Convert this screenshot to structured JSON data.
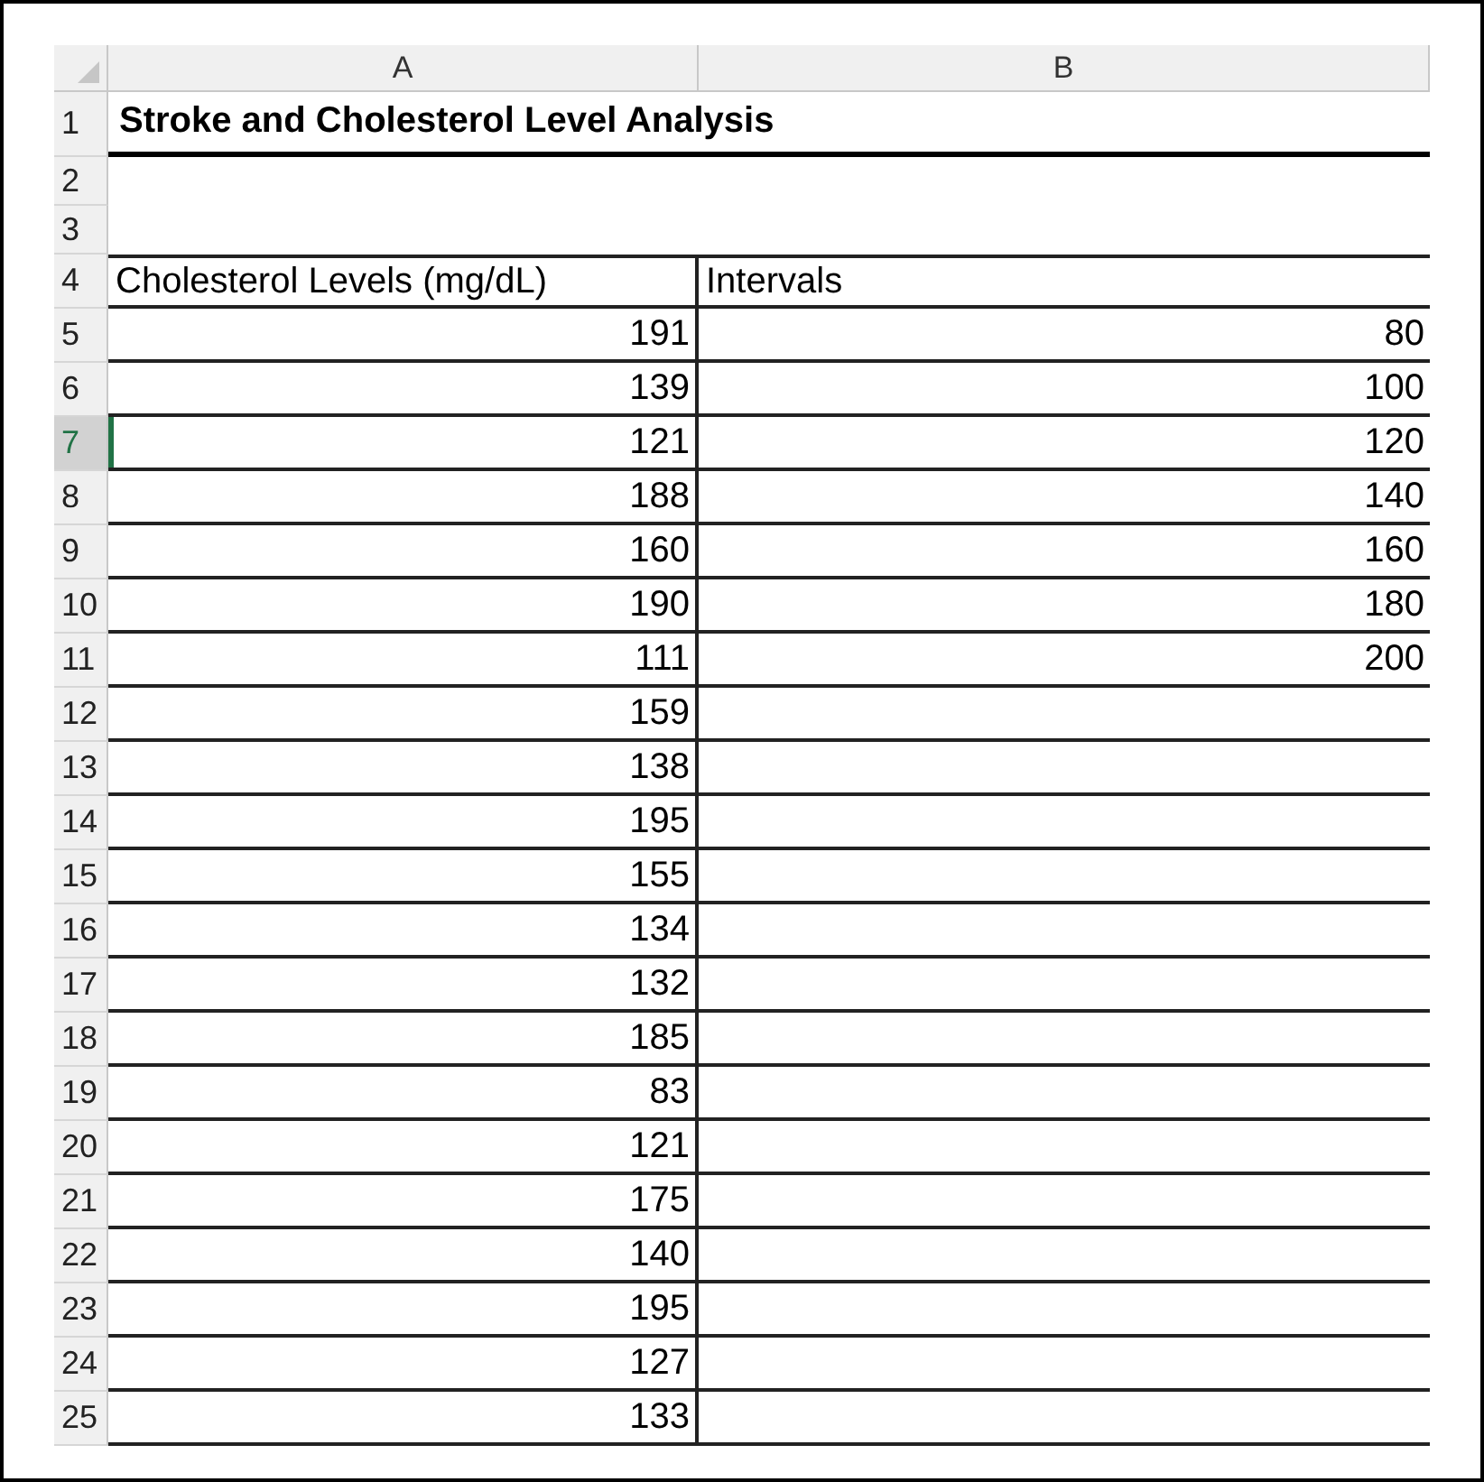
{
  "columns": [
    {
      "label": "A"
    },
    {
      "label": "B"
    }
  ],
  "rows": [
    {
      "number": "1",
      "kind": "title",
      "selected": false,
      "a": "Stroke and Cholesterol Level Analysis"
    },
    {
      "number": "2",
      "kind": "blank",
      "selected": false
    },
    {
      "number": "3",
      "kind": "blank",
      "selected": false
    },
    {
      "number": "4",
      "kind": "header",
      "selected": false,
      "a": "Cholesterol Levels (mg/dL)",
      "b": "Intervals"
    },
    {
      "number": "5",
      "kind": "data",
      "selected": false,
      "a": "191",
      "b": "80"
    },
    {
      "number": "6",
      "kind": "data",
      "selected": false,
      "a": "139",
      "b": "100"
    },
    {
      "number": "7",
      "kind": "data",
      "selected": true,
      "a": "121",
      "b": "120"
    },
    {
      "number": "8",
      "kind": "data",
      "selected": false,
      "a": "188",
      "b": "140"
    },
    {
      "number": "9",
      "kind": "data",
      "selected": false,
      "a": "160",
      "b": "160"
    },
    {
      "number": "10",
      "kind": "data",
      "selected": false,
      "a": "190",
      "b": "180"
    },
    {
      "number": "11",
      "kind": "data",
      "selected": false,
      "a": "111",
      "b": "200"
    },
    {
      "number": "12",
      "kind": "data",
      "selected": false,
      "a": "159"
    },
    {
      "number": "13",
      "kind": "data",
      "selected": false,
      "a": "138"
    },
    {
      "number": "14",
      "kind": "data",
      "selected": false,
      "a": "195"
    },
    {
      "number": "15",
      "kind": "data",
      "selected": false,
      "a": "155"
    },
    {
      "number": "16",
      "kind": "data",
      "selected": false,
      "a": "134"
    },
    {
      "number": "17",
      "kind": "data",
      "selected": false,
      "a": "132"
    },
    {
      "number": "18",
      "kind": "data",
      "selected": false,
      "a": "185"
    },
    {
      "number": "19",
      "kind": "data",
      "selected": false,
      "a": "83"
    },
    {
      "number": "20",
      "kind": "data",
      "selected": false,
      "a": "121"
    },
    {
      "number": "21",
      "kind": "data",
      "selected": false,
      "a": "175"
    },
    {
      "number": "22",
      "kind": "data",
      "selected": false,
      "a": "140"
    },
    {
      "number": "23",
      "kind": "data",
      "selected": false,
      "a": "195"
    },
    {
      "number": "24",
      "kind": "data",
      "selected": false,
      "a": "127"
    },
    {
      "number": "25",
      "kind": "data",
      "selected": false,
      "a": "133"
    }
  ]
}
